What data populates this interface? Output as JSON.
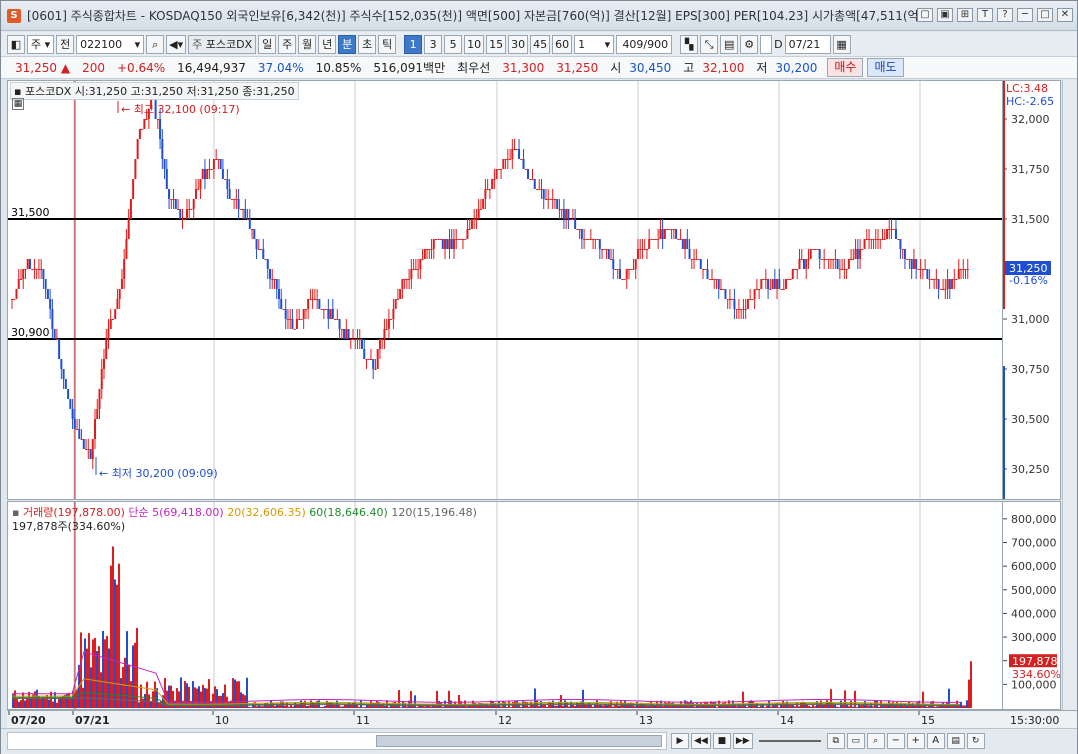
{
  "window": {
    "title": "[0601] 주식종합차트 - KOSDAQ150 외국인보유[6,342(천)] 주식수[152,035(천)] 액면[500] 자본금[760(억)] 결산[12월] EPS[300] PER[104.23] 시가총액[47,511(억)]",
    "logo": "S",
    "buttons": [
      "▢",
      "▣",
      "⊞",
      "T",
      "?",
      "─",
      "□",
      "✕"
    ]
  },
  "toolbar": {
    "market": "주",
    "prefix": "전",
    "code": "022100",
    "stock_name": "포스코DX",
    "periods": [
      "일",
      "주",
      "월",
      "년",
      "분",
      "초",
      "틱"
    ],
    "selected_period": "분",
    "intervals": [
      "1",
      "3",
      "5",
      "10",
      "15",
      "30",
      "45",
      "60"
    ],
    "selected_interval": "1",
    "multiplier": "1",
    "count": "409/900",
    "checkbox_label": "D",
    "date": "07/21"
  },
  "quote": {
    "price": "31,250",
    "arrow": "▲",
    "change": "200",
    "pct": "+0.64%",
    "volume": "16,494,937",
    "ratio": "37.04%",
    "turnover": "10.85%",
    "amount": "516,091백만",
    "best_label": "최우선",
    "ask": "31,300",
    "bid": "31,250",
    "open_label": "시",
    "open": "30,450",
    "high_label": "고",
    "high": "32,100",
    "low_label": "저",
    "low": "30,200",
    "buy": "매수",
    "sell": "매도"
  },
  "price_chart": {
    "legend": "포스코DX 시:31,250 고:31,250 저:31,250 종:31,250",
    "high_note": "최고 32,100 (09:17)",
    "low_note": "최저 30,200 (09:09)",
    "lc": "LC:3.48",
    "hc": "HC:-2.65",
    "current_price": "31,250",
    "current_pct": "-0.16%",
    "h_lines": [
      "31,500",
      "30,900"
    ]
  },
  "volume_chart": {
    "legend": [
      {
        "text": "거래량(197,878.00)",
        "color": "#d42020"
      },
      {
        "text": "단순 5(69,418.00)",
        "color": "#c026c0"
      },
      {
        "text": "20(32,606.35)",
        "color": "#d89a00"
      },
      {
        "text": "60(18,646.40)",
        "color": "#1f8a2e"
      },
      {
        "text": "120(15,196.48)",
        "color": "#666666"
      }
    ],
    "sub_legend": "197,878주(334.60%)",
    "last_value": "197,878",
    "last_pct": "334.60%"
  },
  "chart_data": [
    {
      "type": "candlestick",
      "title": "",
      "ylim": [
        30150,
        32150
      ],
      "yticks": [
        "32,000",
        "31,750",
        "31,500",
        "31,250",
        "31,000",
        "30,750",
        "30,500",
        "30,250"
      ],
      "x_labels": [
        "07/20",
        "07/21",
        "10",
        "11",
        "12",
        "13",
        "14",
        "15"
      ],
      "close_series_approx": [
        31100,
        31300,
        31200,
        30800,
        30450,
        30300,
        30900,
        31200,
        31900,
        32100,
        31600,
        31500,
        31700,
        31800,
        31600,
        31500,
        31300,
        31100,
        30950,
        31100,
        31050,
        30950,
        30900,
        30750,
        31000,
        31200,
        31300,
        31400,
        31350,
        31450,
        31600,
        31750,
        31850,
        31700,
        31600,
        31550,
        31450,
        31400,
        31300,
        31200,
        31350,
        31400,
        31450,
        31350,
        31250,
        31150,
        31050,
        31100,
        31200,
        31150,
        31250,
        31350,
        31300,
        31250,
        31350,
        31400,
        31450,
        31300,
        31250,
        31150,
        31200,
        31250
      ]
    },
    {
      "type": "bar",
      "title": "",
      "ylim": [
        0,
        850000
      ],
      "yticks": [
        "800,000",
        "700,000",
        "600,000",
        "500,000",
        "400,000",
        "300,000",
        "200,000",
        "100,000"
      ],
      "series": [
        {
          "name": "거래량",
          "last": 197878
        }
      ],
      "moving_averages": [
        {
          "name": "단순 5",
          "value": 69418
        },
        {
          "name": "20",
          "value": 32606.35
        },
        {
          "name": "60",
          "value": 18646.4
        },
        {
          "name": "120",
          "value": 15196.48
        }
      ]
    }
  ],
  "xaxis": {
    "labels": [
      "07/20",
      "07/21",
      "10",
      "11",
      "12",
      "13",
      "14",
      "15"
    ],
    "time": "15:30:00"
  },
  "colors": {
    "up": "#e01c1c",
    "down": "#1f4fd0",
    "accent": "#3d78c9"
  }
}
